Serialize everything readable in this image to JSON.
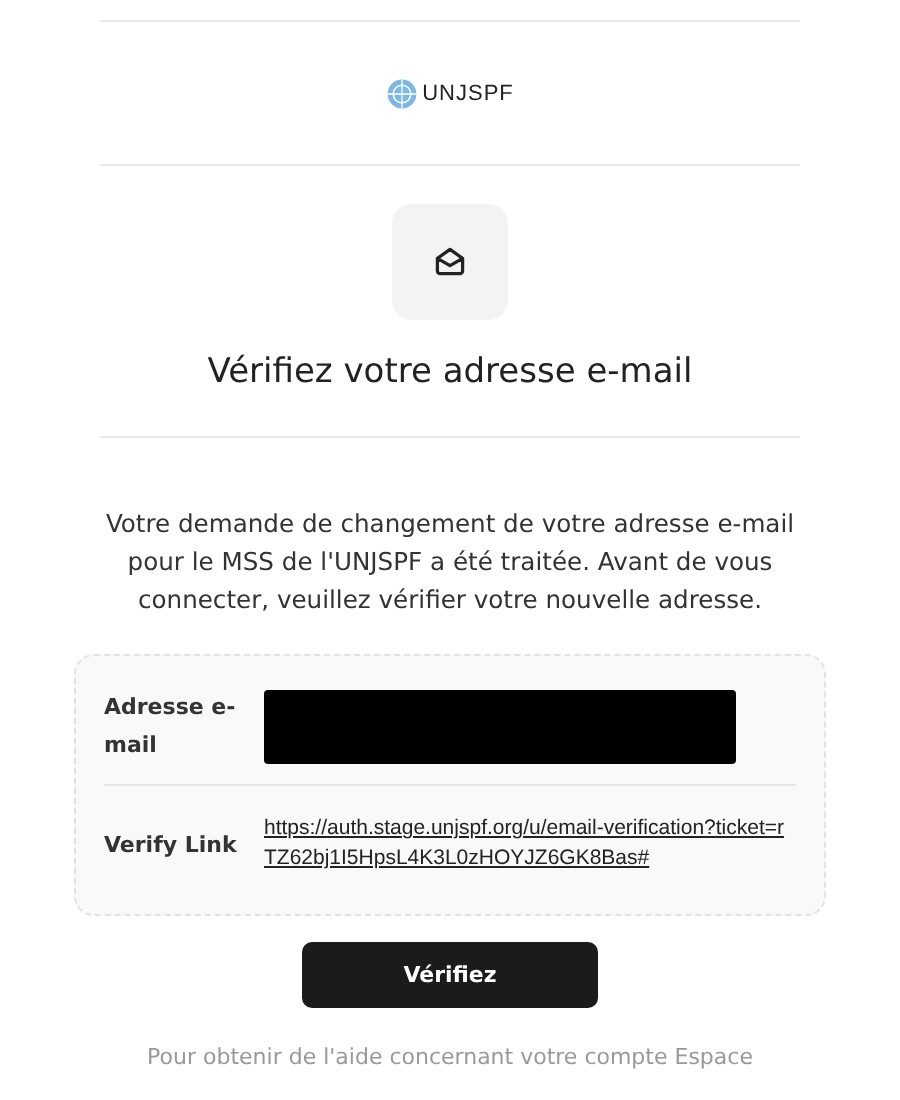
{
  "logo": {
    "text": "UNJSPF"
  },
  "title": "Vérifiez votre adresse e-mail",
  "message": "Votre demande de changement de votre adresse e-mail pour le MSS de l'UNJSPF a été traitée. Avant de vous connecter, veuillez vérifier votre nouvelle adresse.",
  "details": [
    {
      "kind": "redacted",
      "label": "Adresse e-mail"
    },
    {
      "kind": "link",
      "label": "Verify Link",
      "value": "https://auth.stage.unjspf.org/u/email-verification?ticket=rTZ62bj1I5HpsL4K3L0zHOYJZ6GK8Bas#"
    }
  ],
  "button": "Vérifiez",
  "footer": "Pour obtenir de l'aide concernant votre compte Espace"
}
